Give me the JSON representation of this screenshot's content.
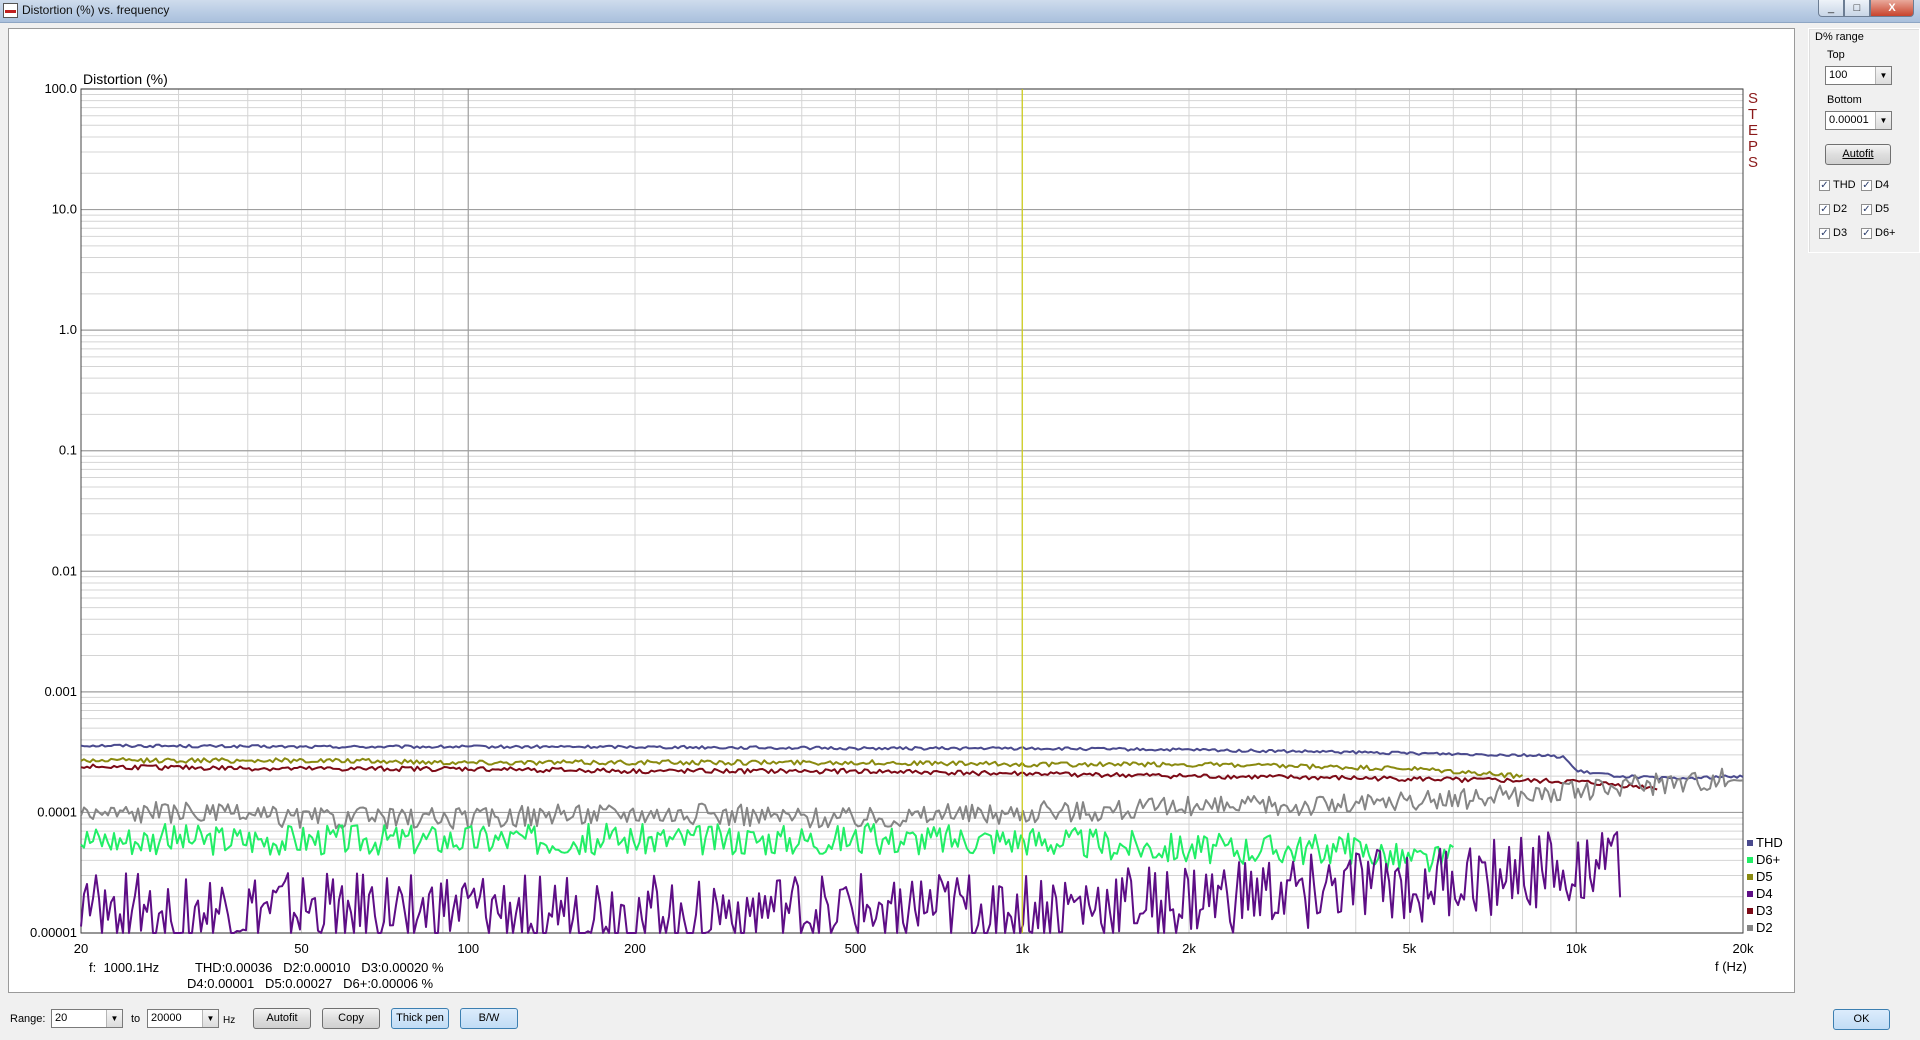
{
  "window": {
    "title": "Distortion (%) vs. frequency",
    "controls": [
      "_",
      "□",
      "X"
    ]
  },
  "chart_data": {
    "type": "line",
    "title": "Distortion (%)",
    "xlabel": "f (Hz)",
    "x_scale": "log",
    "y_scale": "log",
    "xlim": [
      20,
      20000
    ],
    "ylim": [
      1e-05,
      100
    ],
    "x_ticks": [
      "20",
      "50",
      "100",
      "200",
      "500",
      "1k",
      "2k",
      "5k",
      "10k",
      "20k"
    ],
    "y_ticks": [
      "100.0",
      "10.0",
      "1.0",
      "0.1",
      "0.01",
      "0.001",
      "0.0001",
      "0.00001"
    ],
    "steps_label": "STEPS",
    "cursor_x": 1000.1,
    "legend": [
      "THD",
      "D6+",
      "D5",
      "D4",
      "D3",
      "D2"
    ],
    "colors": {
      "THD": "#4a4a8e",
      "D6+": "#22ee66",
      "D5": "#8a8a10",
      "D4": "#5e0e86",
      "D3": "#7d0a16",
      "D2": "#858585",
      "cursor": "#d8d800",
      "steps": "#8b1a1a"
    },
    "series": [
      {
        "name": "THD",
        "x": [
          20,
          50,
          100,
          200,
          500,
          1000,
          2000,
          5000,
          8000,
          9500,
          10000,
          12000,
          15000,
          20000
        ],
        "y": [
          0.00036,
          0.00035,
          0.00035,
          0.00035,
          0.00034,
          0.00034,
          0.00033,
          0.00031,
          0.0003,
          0.00029,
          0.00022,
          0.0002,
          0.00019,
          0.0002
        ]
      },
      {
        "name": "D5",
        "x": [
          20,
          50,
          100,
          200,
          500,
          1000,
          2000,
          5000,
          8000
        ],
        "y": [
          0.00027,
          0.00027,
          0.00026,
          0.00026,
          0.00026,
          0.00025,
          0.00025,
          0.00023,
          0.0002
        ]
      },
      {
        "name": "D3",
        "x": [
          20,
          50,
          100,
          200,
          500,
          1000,
          2000,
          5000,
          10000,
          14000
        ],
        "y": [
          0.00024,
          0.00023,
          0.00023,
          0.00022,
          0.00022,
          0.00021,
          0.0002,
          0.00019,
          0.00018,
          0.00016
        ]
      },
      {
        "name": "D2",
        "x": [
          20,
          30,
          50,
          100,
          200,
          500,
          1000,
          2000,
          5000,
          10000,
          20000
        ],
        "y": [
          0.0001,
          0.0001,
          9e-05,
          9e-05,
          0.0001,
          9e-05,
          0.0001,
          0.00011,
          0.00012,
          0.00015,
          0.0002
        ]
      },
      {
        "name": "D6+",
        "x": [
          20,
          50,
          100,
          200,
          500,
          1000,
          2000,
          3000,
          4000,
          5000,
          6000
        ],
        "y": [
          6e-05,
          6e-05,
          6e-05,
          6e-05,
          6e-05,
          6e-05,
          5e-05,
          5e-05,
          5e-05,
          4e-05,
          4e-05
        ]
      },
      {
        "name": "D4",
        "x": [
          20,
          50,
          100,
          200,
          500,
          1000,
          2000,
          5000,
          8000,
          10000,
          12000
        ],
        "y": [
          1.5e-05,
          1.5e-05,
          1.5e-05,
          1.5e-05,
          1.5e-05,
          1.5e-05,
          1.8e-05,
          2.5e-05,
          3e-05,
          4e-05,
          4e-05
        ]
      }
    ]
  },
  "readout": {
    "line1": "f:  1000.1Hz          THD:0.00036   D2:0.00010   D3:0.00020 %",
    "line2": "D4:0.00001   D5:0.00027   D6+:0.00006 %"
  },
  "side_panel": {
    "title": "D% range",
    "top_label": "Top",
    "top_value": "100",
    "bottom_label": "Bottom",
    "bottom_value": "0.00001",
    "autofit": "Autofit",
    "checks": [
      {
        "label": "THD",
        "checked": true
      },
      {
        "label": "D4",
        "checked": true
      },
      {
        "label": "D2",
        "checked": true
      },
      {
        "label": "D5",
        "checked": true
      },
      {
        "label": "D3",
        "checked": true
      },
      {
        "label": "D6+",
        "checked": true
      }
    ]
  },
  "bottom_bar": {
    "range_label": "Range:",
    "range_from": "20",
    "to_label": "to",
    "range_to": "20000",
    "hz_label": "Hz",
    "autofit": "Autofit",
    "copy": "Copy",
    "thick_pen": "Thick pen",
    "bw": "B/W",
    "ok": "OK"
  }
}
